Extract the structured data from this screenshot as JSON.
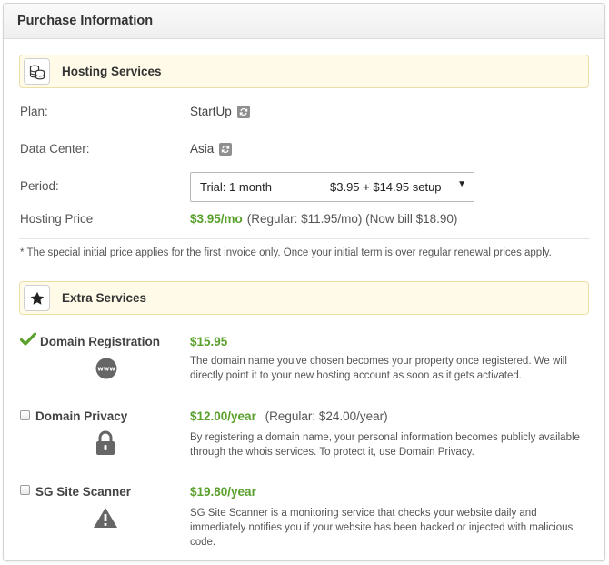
{
  "header": {
    "title": "Purchase Information"
  },
  "hosting": {
    "section_title": "Hosting Services",
    "section_icon": "coins-icon",
    "plan_label": "Plan:",
    "plan_value": "StartUp",
    "datacenter_label": "Data Center:",
    "datacenter_value": "Asia",
    "period_label": "Period:",
    "period_selected_term": "Trial: 1 month",
    "period_selected_price": "$3.95 + $14.95 setup",
    "price_label": "Hosting Price",
    "price_value": "$3.95/mo",
    "price_regular": "(Regular: $11.95/mo) (Now bill $18.90)",
    "note": "* The special initial price applies for the first invoice only. Once your initial term is over regular renewal prices apply."
  },
  "extras": {
    "section_title": "Extra Services",
    "section_icon": "star-icon",
    "items": [
      {
        "name": "Domain Registration",
        "price": "$15.95",
        "regular": "",
        "selected": true,
        "icon": "www-icon",
        "description": "The domain name you've chosen becomes your property once registered. We will directly point it to your new hosting account as soon as it gets activated."
      },
      {
        "name": "Domain Privacy",
        "price": "$12.00/year",
        "regular": "(Regular: $24.00/year)",
        "selected": false,
        "icon": "lock-icon",
        "description": "By registering a domain name, your personal information becomes publicly available through the whois services. To protect it, use Domain Privacy."
      },
      {
        "name": "SG Site Scanner",
        "price": "$19.80/year",
        "regular": "",
        "selected": false,
        "icon": "warning-icon",
        "description": "SG Site Scanner is a monitoring service that checks your website daily and immediately notifies you if your website has been hacked or injected with malicious code."
      }
    ]
  },
  "colors": {
    "accent_green": "#5aa02c",
    "section_bg": "#fffbe8"
  }
}
